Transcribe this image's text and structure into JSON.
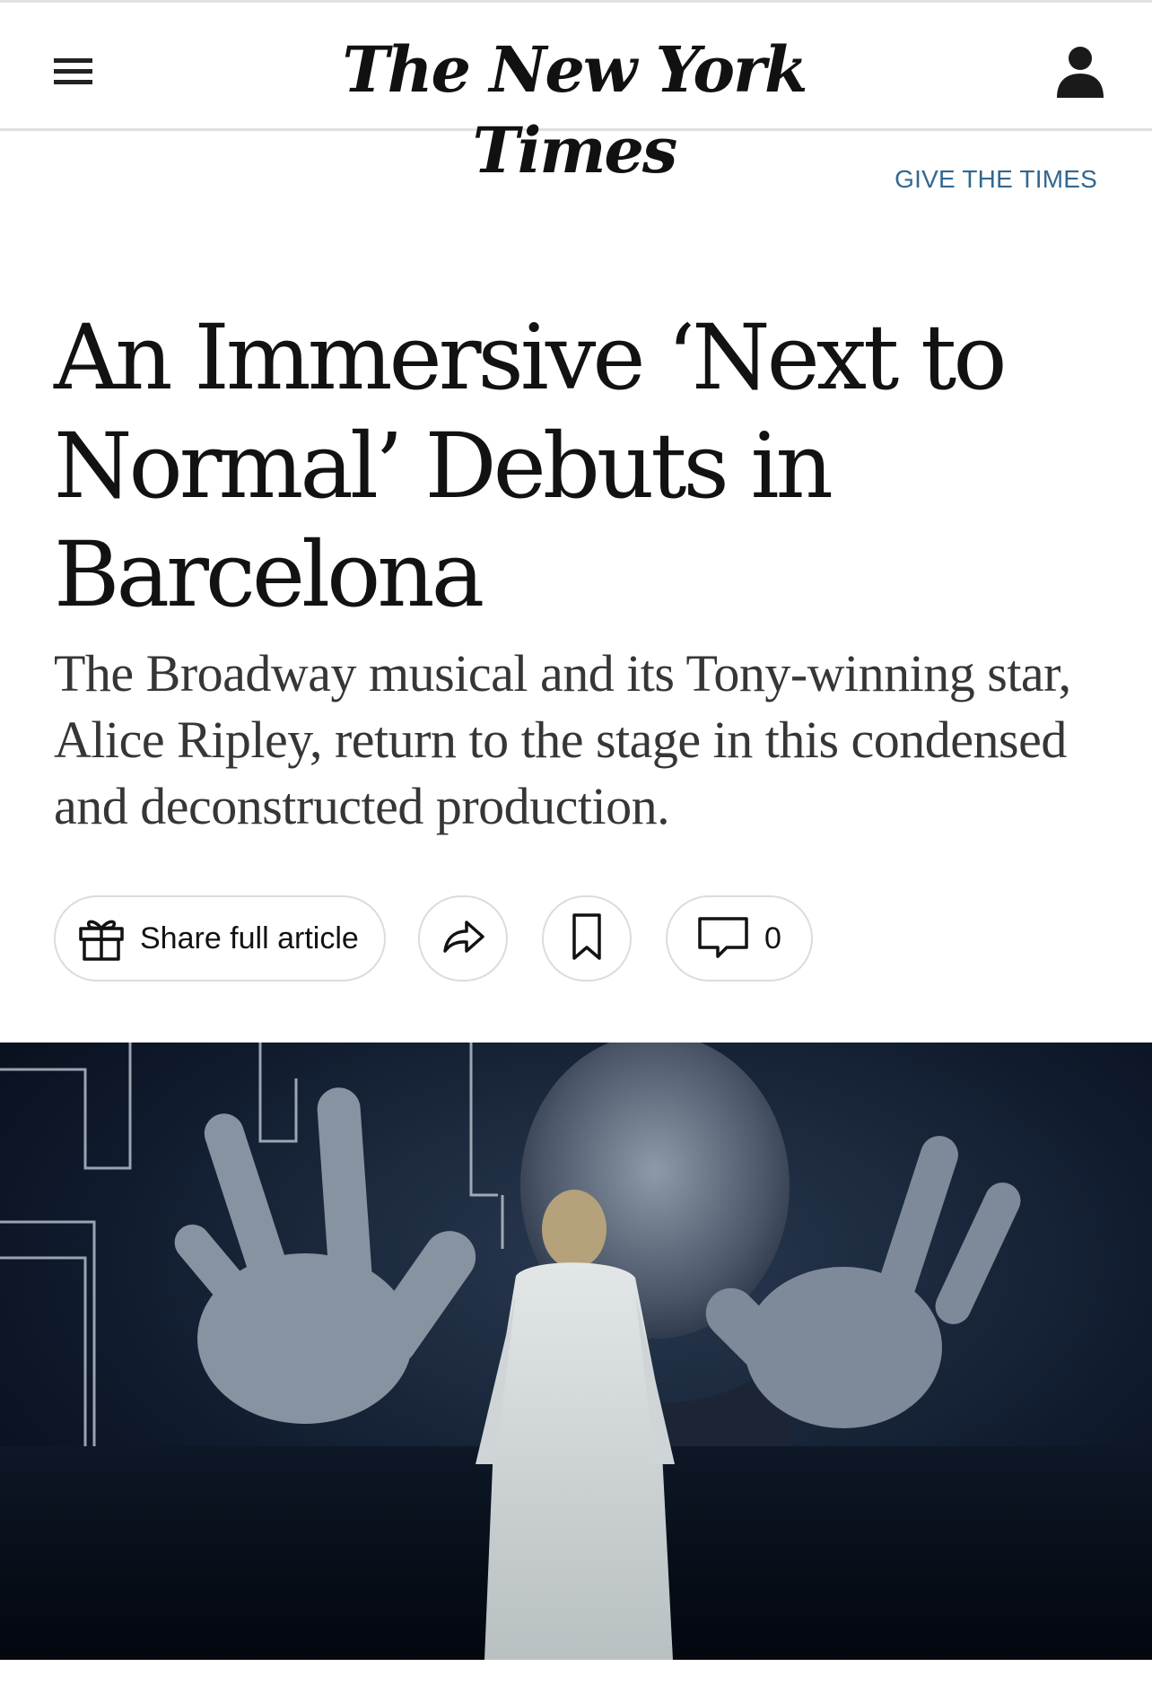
{
  "header": {
    "masthead": "The New York Times",
    "menu_icon": "hamburger-menu-icon",
    "account_icon": "user-account-icon"
  },
  "promo": {
    "give_label": "GIVE THE TIMES"
  },
  "article": {
    "headline": "An Immersive ‘Next to Normal’ Debuts in Barcelona",
    "summary": "The Broadway musical and its Tony-winning star, Alice Ripley, return to the stage in this condensed and deconstructed production."
  },
  "toolbar": {
    "share_full_label": "Share full article",
    "gift_icon": "gift-icon",
    "share_icon": "share-arrow-icon",
    "save_icon": "bookmark-icon",
    "comment_icon": "comment-bubble-icon",
    "comment_count": "0"
  },
  "colors": {
    "link_blue": "#326891",
    "text_dark": "#121212",
    "text_summary": "#363636",
    "border_grey": "#dcdcdc"
  }
}
